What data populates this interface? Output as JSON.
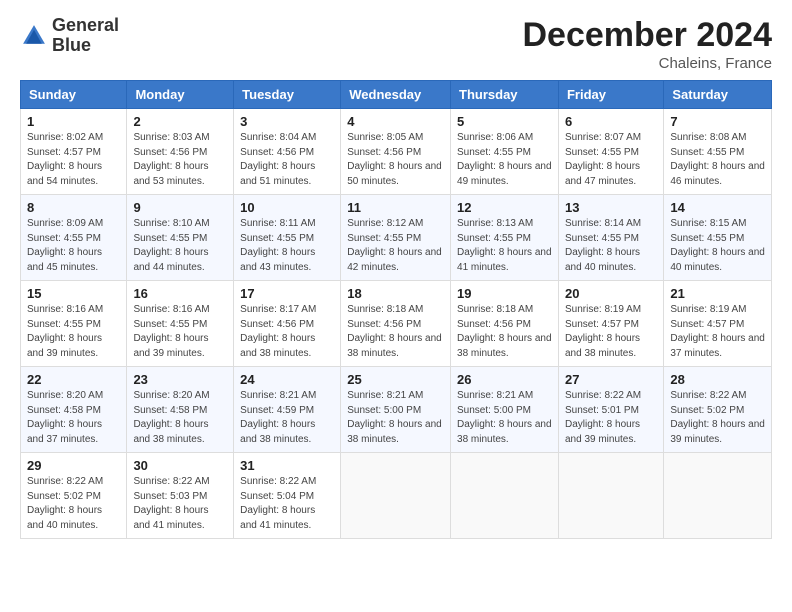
{
  "header": {
    "logo_line1": "General",
    "logo_line2": "Blue",
    "month_year": "December 2024",
    "location": "Chaleins, France"
  },
  "days_of_week": [
    "Sunday",
    "Monday",
    "Tuesday",
    "Wednesday",
    "Thursday",
    "Friday",
    "Saturday"
  ],
  "weeks": [
    [
      {
        "day": "1",
        "sunrise": "8:02 AM",
        "sunset": "4:57 PM",
        "daylight": "8 hours and 54 minutes."
      },
      {
        "day": "2",
        "sunrise": "8:03 AM",
        "sunset": "4:56 PM",
        "daylight": "8 hours and 53 minutes."
      },
      {
        "day": "3",
        "sunrise": "8:04 AM",
        "sunset": "4:56 PM",
        "daylight": "8 hours and 51 minutes."
      },
      {
        "day": "4",
        "sunrise": "8:05 AM",
        "sunset": "4:56 PM",
        "daylight": "8 hours and 50 minutes."
      },
      {
        "day": "5",
        "sunrise": "8:06 AM",
        "sunset": "4:55 PM",
        "daylight": "8 hours and 49 minutes."
      },
      {
        "day": "6",
        "sunrise": "8:07 AM",
        "sunset": "4:55 PM",
        "daylight": "8 hours and 47 minutes."
      },
      {
        "day": "7",
        "sunrise": "8:08 AM",
        "sunset": "4:55 PM",
        "daylight": "8 hours and 46 minutes."
      }
    ],
    [
      {
        "day": "8",
        "sunrise": "8:09 AM",
        "sunset": "4:55 PM",
        "daylight": "8 hours and 45 minutes."
      },
      {
        "day": "9",
        "sunrise": "8:10 AM",
        "sunset": "4:55 PM",
        "daylight": "8 hours and 44 minutes."
      },
      {
        "day": "10",
        "sunrise": "8:11 AM",
        "sunset": "4:55 PM",
        "daylight": "8 hours and 43 minutes."
      },
      {
        "day": "11",
        "sunrise": "8:12 AM",
        "sunset": "4:55 PM",
        "daylight": "8 hours and 42 minutes."
      },
      {
        "day": "12",
        "sunrise": "8:13 AM",
        "sunset": "4:55 PM",
        "daylight": "8 hours and 41 minutes."
      },
      {
        "day": "13",
        "sunrise": "8:14 AM",
        "sunset": "4:55 PM",
        "daylight": "8 hours and 40 minutes."
      },
      {
        "day": "14",
        "sunrise": "8:15 AM",
        "sunset": "4:55 PM",
        "daylight": "8 hours and 40 minutes."
      }
    ],
    [
      {
        "day": "15",
        "sunrise": "8:16 AM",
        "sunset": "4:55 PM",
        "daylight": "8 hours and 39 minutes."
      },
      {
        "day": "16",
        "sunrise": "8:16 AM",
        "sunset": "4:55 PM",
        "daylight": "8 hours and 39 minutes."
      },
      {
        "day": "17",
        "sunrise": "8:17 AM",
        "sunset": "4:56 PM",
        "daylight": "8 hours and 38 minutes."
      },
      {
        "day": "18",
        "sunrise": "8:18 AM",
        "sunset": "4:56 PM",
        "daylight": "8 hours and 38 minutes."
      },
      {
        "day": "19",
        "sunrise": "8:18 AM",
        "sunset": "4:56 PM",
        "daylight": "8 hours and 38 minutes."
      },
      {
        "day": "20",
        "sunrise": "8:19 AM",
        "sunset": "4:57 PM",
        "daylight": "8 hours and 38 minutes."
      },
      {
        "day": "21",
        "sunrise": "8:19 AM",
        "sunset": "4:57 PM",
        "daylight": "8 hours and 37 minutes."
      }
    ],
    [
      {
        "day": "22",
        "sunrise": "8:20 AM",
        "sunset": "4:58 PM",
        "daylight": "8 hours and 37 minutes."
      },
      {
        "day": "23",
        "sunrise": "8:20 AM",
        "sunset": "4:58 PM",
        "daylight": "8 hours and 38 minutes."
      },
      {
        "day": "24",
        "sunrise": "8:21 AM",
        "sunset": "4:59 PM",
        "daylight": "8 hours and 38 minutes."
      },
      {
        "day": "25",
        "sunrise": "8:21 AM",
        "sunset": "5:00 PM",
        "daylight": "8 hours and 38 minutes."
      },
      {
        "day": "26",
        "sunrise": "8:21 AM",
        "sunset": "5:00 PM",
        "daylight": "8 hours and 38 minutes."
      },
      {
        "day": "27",
        "sunrise": "8:22 AM",
        "sunset": "5:01 PM",
        "daylight": "8 hours and 39 minutes."
      },
      {
        "day": "28",
        "sunrise": "8:22 AM",
        "sunset": "5:02 PM",
        "daylight": "8 hours and 39 minutes."
      }
    ],
    [
      {
        "day": "29",
        "sunrise": "8:22 AM",
        "sunset": "5:02 PM",
        "daylight": "8 hours and 40 minutes."
      },
      {
        "day": "30",
        "sunrise": "8:22 AM",
        "sunset": "5:03 PM",
        "daylight": "8 hours and 41 minutes."
      },
      {
        "day": "31",
        "sunrise": "8:22 AM",
        "sunset": "5:04 PM",
        "daylight": "8 hours and 41 minutes."
      },
      null,
      null,
      null,
      null
    ]
  ]
}
